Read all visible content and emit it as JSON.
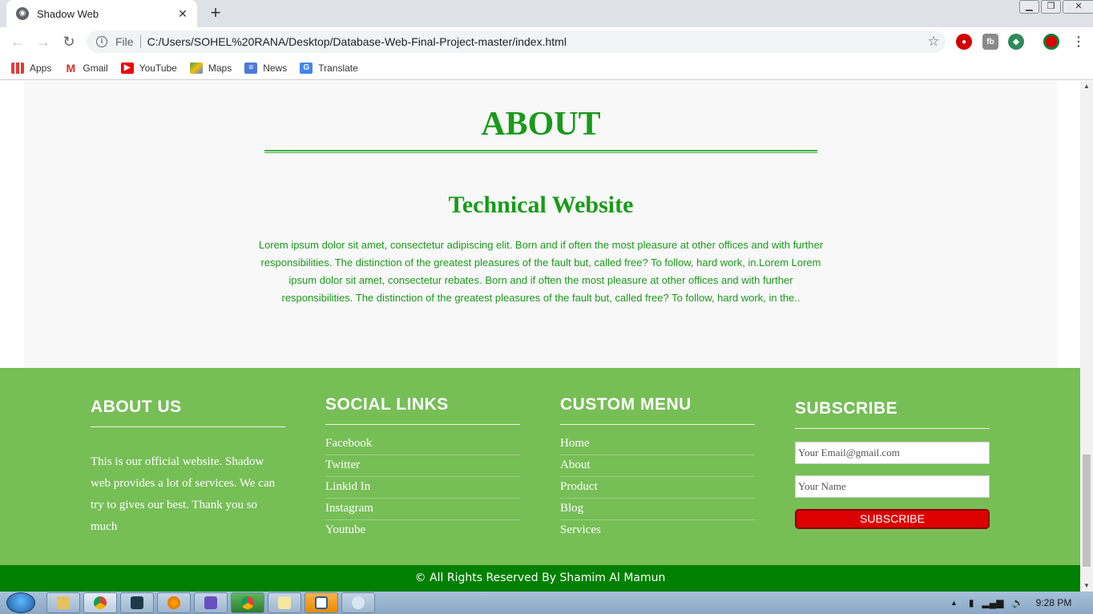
{
  "browser": {
    "tab_title": "Shadow Web",
    "tab_close": "✕",
    "new_tab": "+",
    "address_label": "File",
    "url": "C:/Users/SOHEL%20RANA/Desktop/Database-Web-Final-Project-master/index.html",
    "bookmarks": [
      "Apps",
      "Gmail",
      "YouTube",
      "Maps",
      "News",
      "Translate"
    ]
  },
  "about": {
    "heading": "ABOUT",
    "subheading": "Technical Website",
    "body": "Lorem ipsum dolor sit amet, consectetur adipiscing elit. Born and if often the most pleasure at other offices and with further responsibilities. The distinction of the greatest pleasures of the fault but, called free? To follow, hard work, in.Lorem Lorem ipsum dolor sit amet, consectetur rebates. Born and if often the most pleasure at other offices and with further responsibilities. The distinction of the greatest pleasures of the fault but, called free? To follow, hard work, in the.."
  },
  "footer": {
    "about_us": {
      "title": "ABOUT US",
      "text": "This is our official website. Shadow web provides a lot of services. We can try to gives our best. Thank you so much"
    },
    "social": {
      "title": "SOCIAL LINKS",
      "links": [
        "Facebook",
        "Twitter",
        "Linkid In",
        "Instagram",
        "Youtube"
      ]
    },
    "menu": {
      "title": "CUSTOM MENU",
      "links": [
        "Home",
        "About",
        "Product",
        "Blog",
        "Services"
      ]
    },
    "subscribe": {
      "title": "SUBSCRIBE",
      "email_placeholder": "Your Email@gmail.com",
      "name_placeholder": "Your Name",
      "button": "SUBSCRIBE"
    },
    "copyright": "© All Rights Reserved By Shamim Al Mamun"
  },
  "taskbar": {
    "clock": "9:28 PM"
  },
  "colors": {
    "accent_green": "#1a9a1a",
    "footer_green": "#77be57",
    "copyright_green": "#008000",
    "subscribe_red": "#dd0000"
  }
}
